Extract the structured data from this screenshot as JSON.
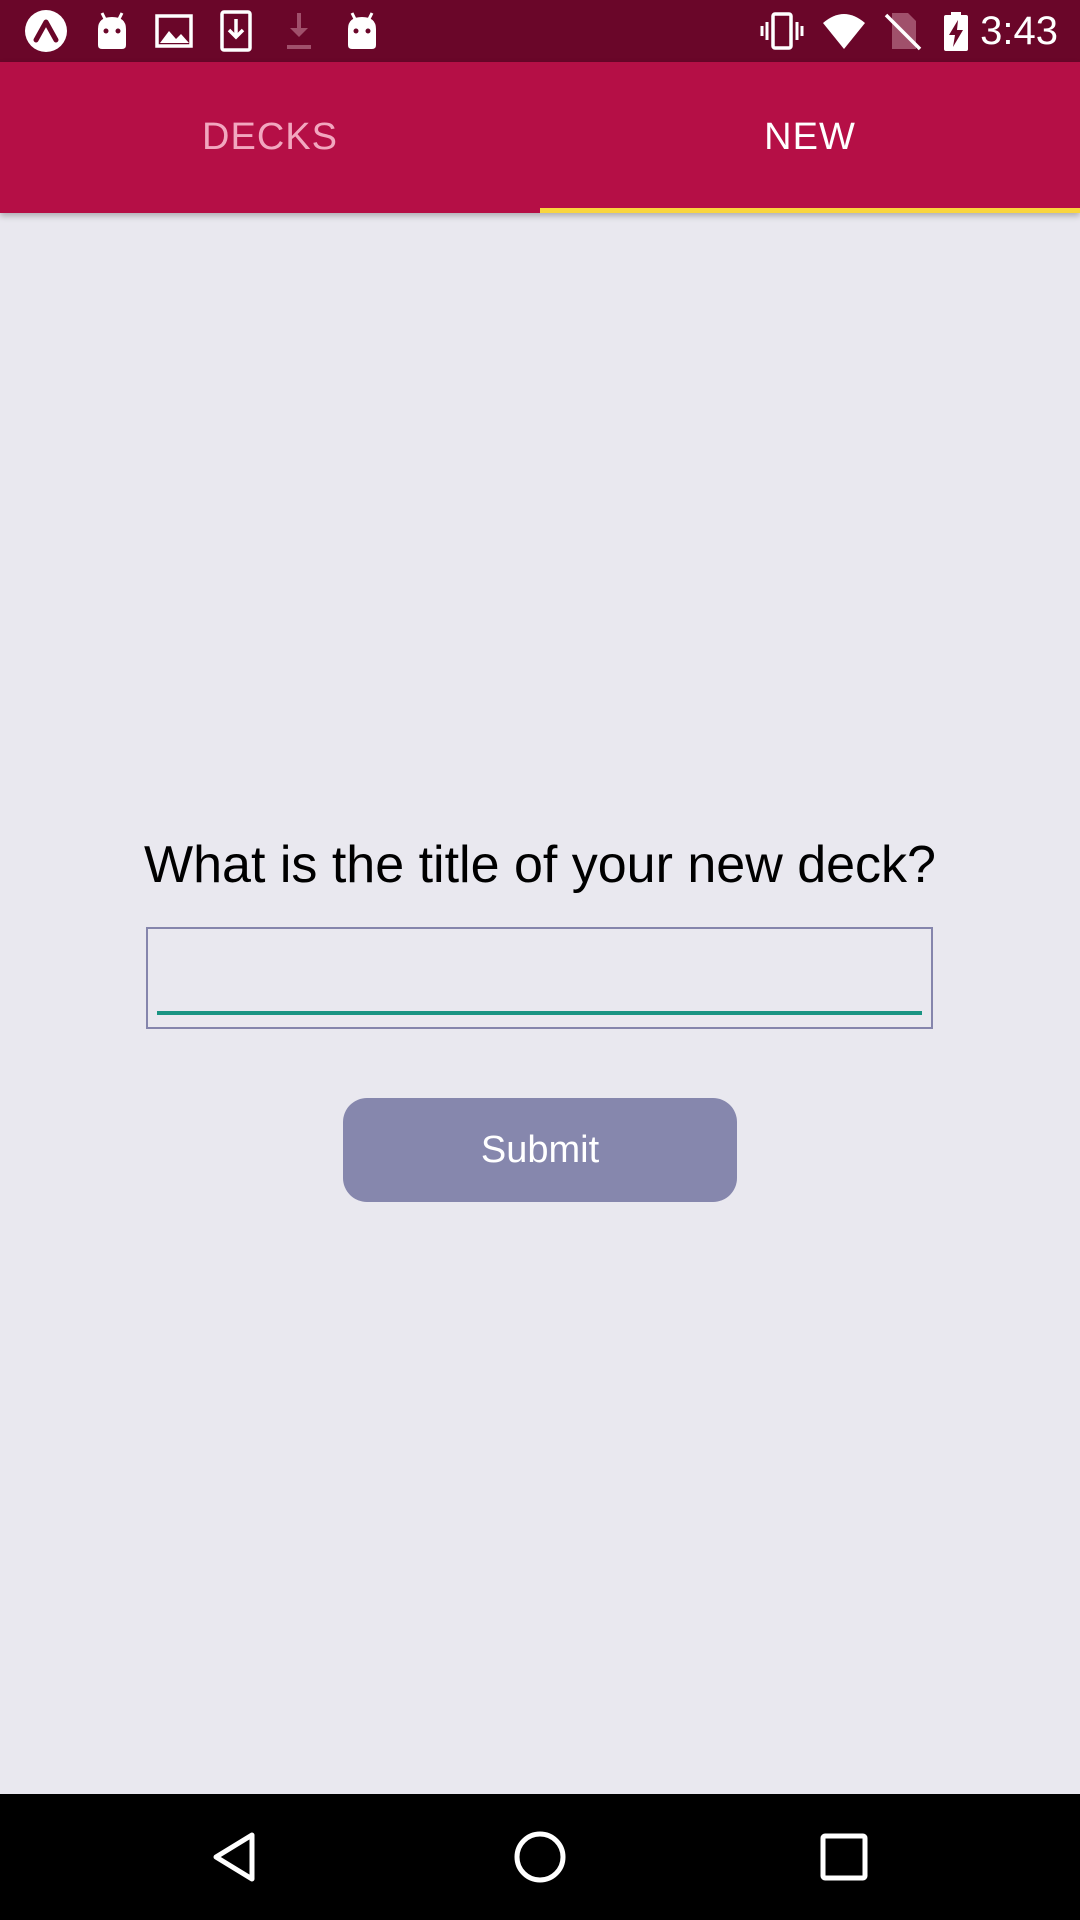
{
  "status_bar": {
    "time": "3:43",
    "left_icons": [
      "expo-icon",
      "android-icon",
      "image-icon",
      "download-box-icon",
      "download-icon",
      "android-icon"
    ],
    "right_icons": [
      "vibrate-icon",
      "wifi-icon",
      "no-sim-icon",
      "battery-charging-icon"
    ]
  },
  "tabs": [
    {
      "label": "DECKS",
      "active": false
    },
    {
      "label": "NEW",
      "active": true
    }
  ],
  "form": {
    "prompt": "What is the title of your new deck?",
    "input_value": "",
    "submit_label": "Submit"
  },
  "nav_bar": {
    "buttons": [
      "back-icon",
      "home-icon",
      "recents-icon"
    ]
  },
  "colors": {
    "status_bar": "#6a0629",
    "tab_bar": "#b50f46",
    "tab_indicator": "#f9d53e",
    "background": "#e9e8ef",
    "button": "#8687ad",
    "input_underline": "#1a9483"
  }
}
